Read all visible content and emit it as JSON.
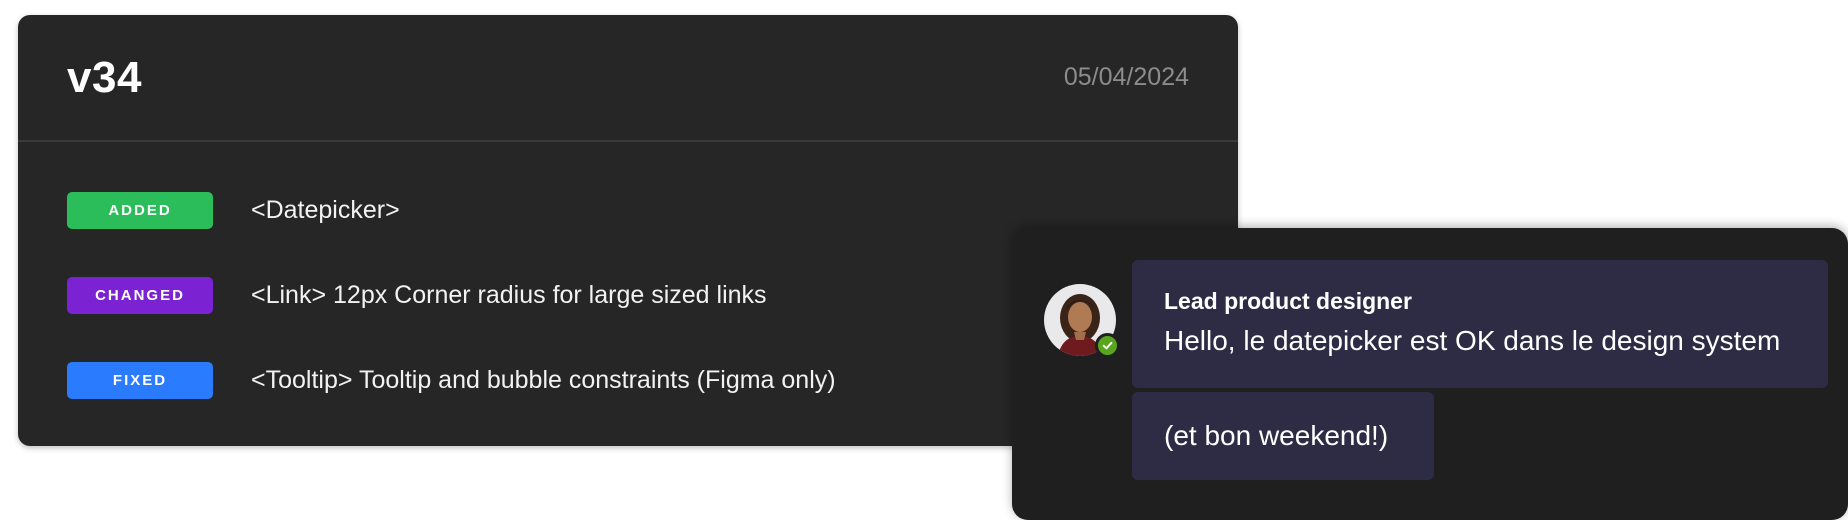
{
  "changelog": {
    "version": "v34",
    "date": "05/04/2024",
    "entries": [
      {
        "badge": "ADDED",
        "badge_color": "#2cbd5b",
        "text": "<Datepicker>"
      },
      {
        "badge": "CHANGED",
        "badge_color": "#7b22d3",
        "text": "<Link> 12px Corner radius for large sized links"
      },
      {
        "badge": "FIXED",
        "badge_color": "#2b7bff",
        "text": "<Tooltip> Tooltip and bubble constraints (Figma only)"
      }
    ]
  },
  "chat": {
    "sender": "Lead product designer",
    "messages": [
      "Hello, le datepicker est OK dans le design system",
      "(et bon weekend!)"
    ],
    "presence_color": "#5aa51f",
    "bubble_color": "#2e2b45",
    "avatar_icon": "user-avatar",
    "status_icon": "check-icon"
  }
}
